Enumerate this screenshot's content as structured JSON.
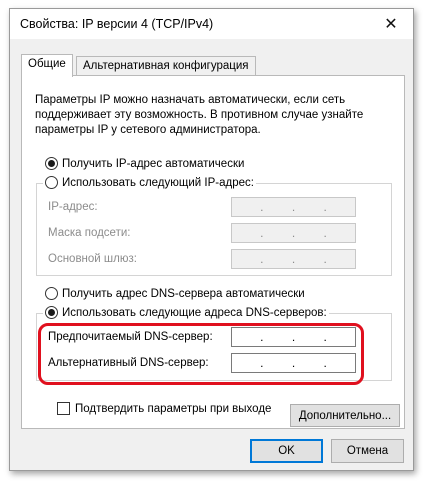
{
  "window": {
    "title": "Свойства: IP версии 4 (TCP/IPv4)",
    "close_glyph": "✕"
  },
  "tabs": [
    {
      "label": "Общие",
      "active": true
    },
    {
      "label": "Альтернативная конфигурация",
      "active": false
    }
  ],
  "info_text": "Параметры IP можно назначать автоматически, если сеть поддерживает эту возможность. В противном случае узнайте параметры IP у сетевого администратора.",
  "ip_section": {
    "auto_label": "Получить IP-адрес автоматически",
    "manual_label": "Использовать следующий IP-адрес:",
    "selected": "auto",
    "fields": [
      {
        "label": "IP-адрес:",
        "value": [
          ".",
          ".",
          "."
        ]
      },
      {
        "label": "Маска подсети:",
        "value": [
          ".",
          ".",
          "."
        ]
      },
      {
        "label": "Основной шлюз:",
        "value": [
          ".",
          ".",
          "."
        ]
      }
    ]
  },
  "dns_section": {
    "auto_label": "Получить адрес DNS-сервера автоматически",
    "manual_label": "Использовать следующие адреса DNS-серверов:",
    "selected": "manual",
    "fields": [
      {
        "label": "Предпочитаемый DNS-сервер:",
        "value": [
          ".",
          ".",
          "."
        ]
      },
      {
        "label": "Альтернативный DNS-сервер:",
        "value": [
          ".",
          ".",
          "."
        ]
      }
    ]
  },
  "validate_checkbox": {
    "label": "Подтвердить параметры при выходе",
    "checked": false
  },
  "buttons": {
    "advanced": "Дополнительно...",
    "ok": "OK",
    "cancel": "Отмена"
  },
  "colors": {
    "highlight": "#e0101e",
    "default_button_border": "#0078d7"
  }
}
